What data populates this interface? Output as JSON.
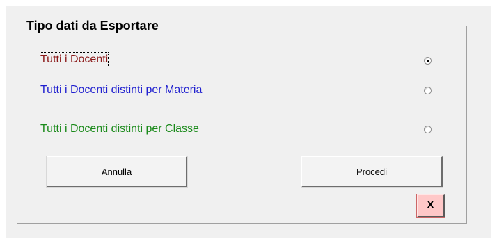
{
  "group": {
    "title": "Tipo dati da Esportare"
  },
  "options": [
    {
      "label": "Tutti i Docenti",
      "color": "#8b1a1a",
      "selected": true
    },
    {
      "label": "Tutti i Docenti distinti per Materia",
      "color": "#1f1fcf",
      "selected": false
    },
    {
      "label": "Tutti i Docenti distinti per Classe",
      "color": "#1a8a1a",
      "selected": false
    }
  ],
  "buttons": {
    "cancel_label": "Annulla",
    "proceed_label": "Procedi",
    "close_label": "X"
  },
  "colors": {
    "dialog_background": "#f0f0f0",
    "close_button_background": "#ffc8c8"
  },
  "icons": {
    "close": "close-icon"
  }
}
